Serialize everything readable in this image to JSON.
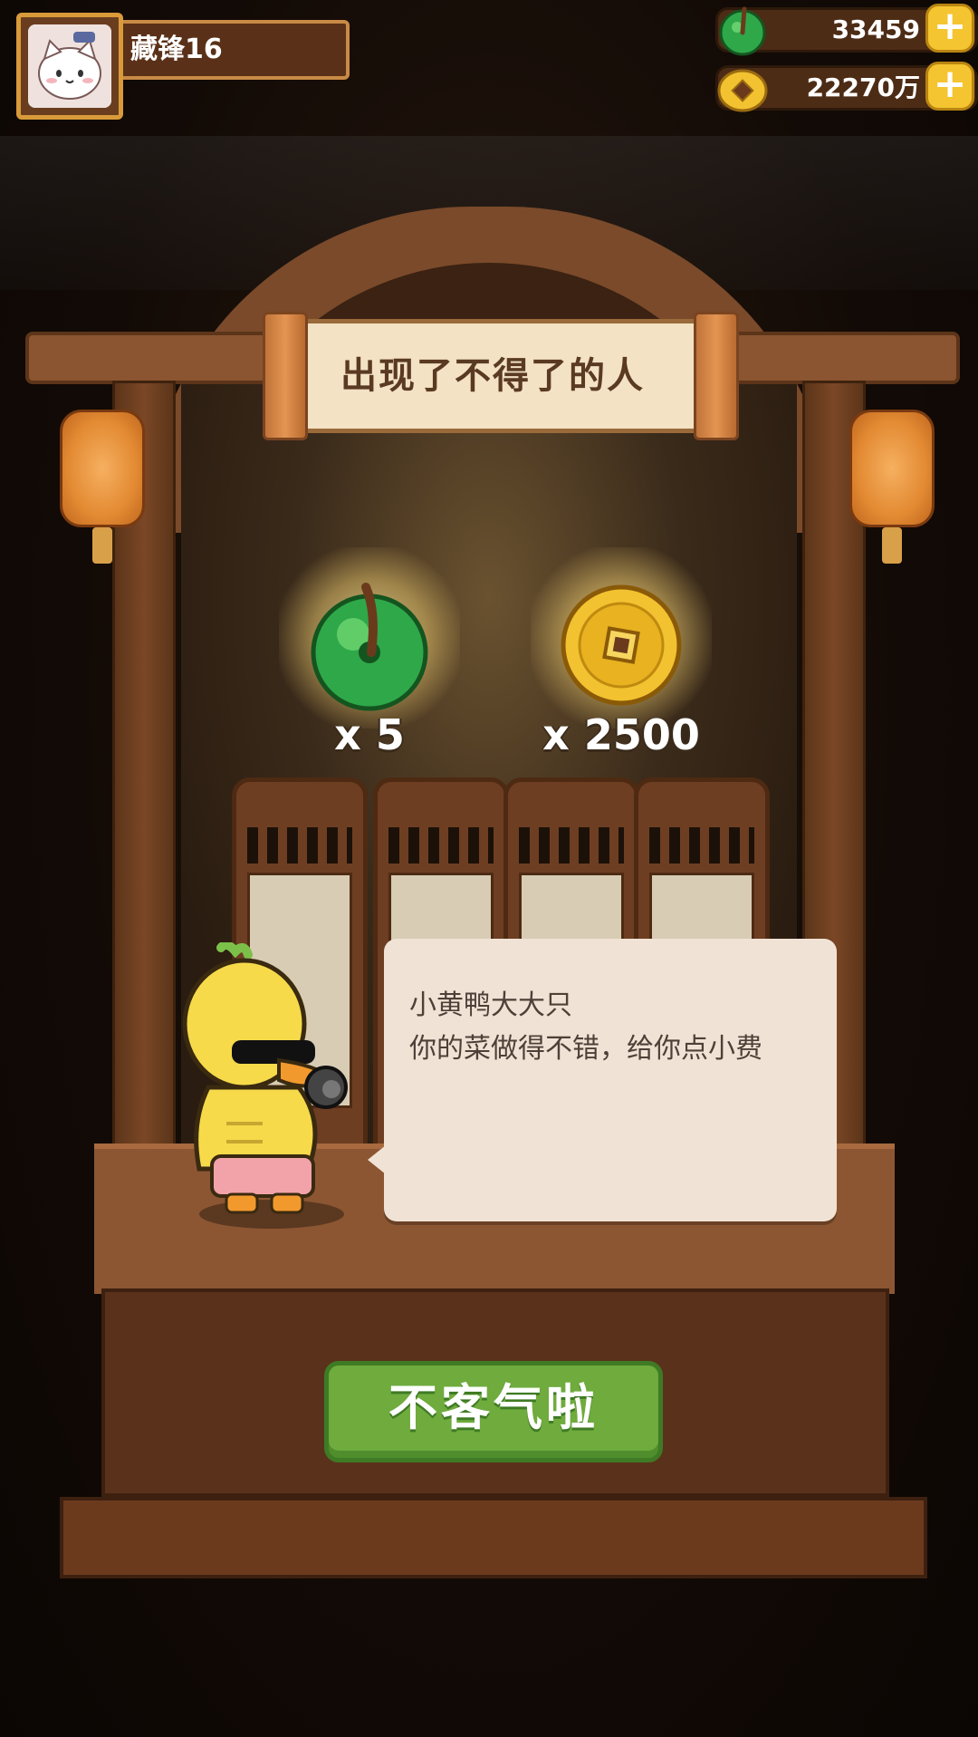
{
  "player": {
    "name": "藏锋16",
    "avatar_icon": "white-cat-avatar"
  },
  "currencies": [
    {
      "icon": "jade-coin-icon",
      "value": "33459"
    },
    {
      "icon": "gold-coin-icon",
      "value": "22270万"
    }
  ],
  "event": {
    "title": "出现了不得了的人",
    "rewards": [
      {
        "icon": "jade-coin-icon",
        "amount": "x 5"
      },
      {
        "icon": "gold-coin-icon",
        "amount": "x 2500"
      }
    ],
    "character": "yellow-duck-with-sunglasses",
    "dialog": {
      "speaker": "小黄鸭大大只",
      "message": "你的菜做得不错，给你点小费"
    },
    "confirm_label": "不客气啦"
  },
  "colors": {
    "accent": "#6fab3d",
    "wood": "#8c5632",
    "gold": "#f5c431",
    "jade": "#2fa84a"
  }
}
